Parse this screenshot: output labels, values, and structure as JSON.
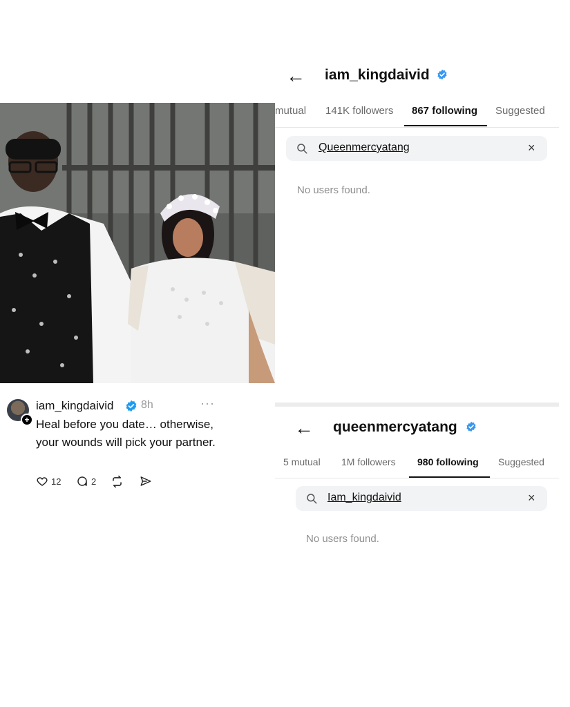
{
  "post": {
    "username": "iam_kingdaivid",
    "time": "8h",
    "more": "···",
    "text": "Heal before you date… otherwise, your wounds will pick your partner.",
    "likes": "12",
    "replies": "2"
  },
  "panel1": {
    "username": "iam_kingdaivid",
    "tabs": [
      "mutual",
      "141K followers",
      "867 following",
      "Suggested"
    ],
    "active_tab": 2,
    "search_value": "Queenmercyatang",
    "empty_text": "No users found."
  },
  "panel2": {
    "username": "queenmercyatang",
    "tabs": [
      "5 mutual",
      "1M followers",
      "980 following",
      "Suggested"
    ],
    "active_tab": 2,
    "search_value": "Iam_kingdaivid",
    "empty_text": "No users found."
  },
  "colors": {
    "verified": "#1d9bf0",
    "ig_verified": "#3897f0"
  },
  "icons": {
    "back": "←",
    "search": "magnifier",
    "clear": "×",
    "heart": "heart",
    "reply": "speech-bubble",
    "repost": "repost-arrows",
    "share": "paper-plane"
  }
}
